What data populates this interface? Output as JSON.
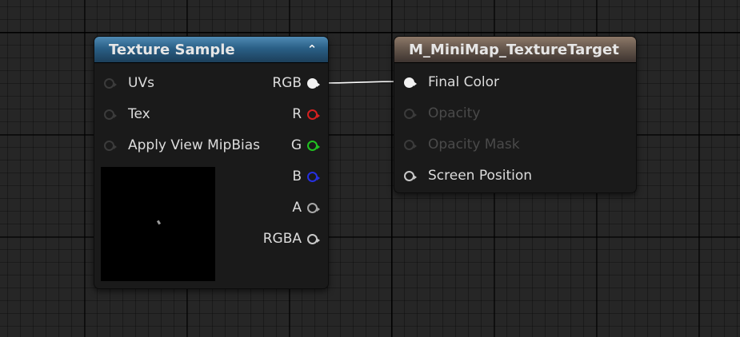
{
  "colors": {
    "texture_header": "#2a5f86",
    "material_header": "#66574c",
    "pin_red": "#d62020",
    "pin_green": "#21c121",
    "pin_blue": "#2630e0",
    "wire": "#ffffff"
  },
  "texture_node": {
    "title": "Texture Sample",
    "collapse_glyph": "⌃",
    "inputs": [
      {
        "label": "UVs",
        "icon": "input-pin-icon"
      },
      {
        "label": "Tex",
        "icon": "input-pin-icon"
      },
      {
        "label": "Apply View MipBias",
        "icon": "input-pin-icon"
      }
    ],
    "outputs": [
      {
        "label": "RGB",
        "color": "white",
        "connected": true
      },
      {
        "label": "R",
        "color": "red"
      },
      {
        "label": "G",
        "color": "green"
      },
      {
        "label": "B",
        "color": "blue"
      },
      {
        "label": "A",
        "color": "gray"
      },
      {
        "label": "RGBA",
        "color": "white"
      }
    ]
  },
  "material_node": {
    "title": "M_MiniMap_TextureTarget",
    "inputs": [
      {
        "label": "Final Color",
        "enabled": true,
        "connected": true
      },
      {
        "label": "Opacity",
        "enabled": false
      },
      {
        "label": "Opacity Mask",
        "enabled": false
      },
      {
        "label": "Screen Position",
        "enabled": true
      }
    ]
  }
}
